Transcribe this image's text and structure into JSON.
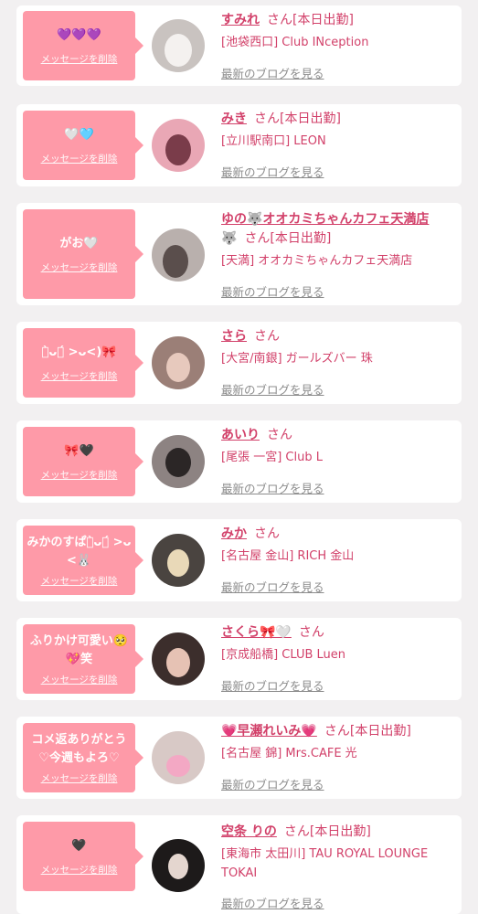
{
  "common": {
    "delete_label": "メッセージを削除",
    "blog_label": "最新のブログを見る"
  },
  "cards": [
    {
      "message": "💜💜💜",
      "name": "すみれ",
      "suffix": "さん[本日出勤]",
      "shop": "[池袋西口] Club INception",
      "avatar_color": "#c9c3c0",
      "avatar_accent": "#f4f1ef"
    },
    {
      "message": "🤍🩵",
      "name": "みき",
      "suffix": "さん[本日出勤]",
      "shop": "[立川駅南口] LEON",
      "avatar_color": "#e9a7b5",
      "avatar_accent": "#7a3c4a"
    },
    {
      "message": "がお🤍",
      "name": "ゆの🐺オオカミちゃんカフェ天満店",
      "name_line2": "🐺",
      "suffix": "さん[本日出勤]",
      "shop": "[天満] オオカミちゃんカフェ天満店",
      "avatar_color": "#b9b0ad",
      "avatar_accent": "#5a4e4c"
    },
    {
      "message": "ก̀ᴗก́ >ᴗ<)🎀",
      "name": "さら",
      "suffix": "さん",
      "shop": "[大宮/南銀] ガールズバー 珠",
      "avatar_color": "#9b7f77",
      "avatar_accent": "#e7c9bd"
    },
    {
      "message": "🎀🖤",
      "name": "あいり",
      "suffix": "さん",
      "shop": "[尾張 一宮] Club L",
      "avatar_color": "#8d8382",
      "avatar_accent": "#2b2626"
    },
    {
      "message": "みかのすぱก̀ᴗก́ >ᴗ<🐰",
      "name": "みか",
      "suffix": "さん",
      "shop": "[名古屋 金山] RICH 金山",
      "avatar_color": "#4a4440",
      "avatar_accent": "#e9d9b8"
    },
    {
      "message": "ふりかけ可愛い🥺💖笑",
      "name": "さくら🎀🤍",
      "suffix": "さん",
      "shop": "[京成船橋] CLUB Luen",
      "avatar_color": "#3c2e2c",
      "avatar_accent": "#e6c2b4"
    },
    {
      "message": "コメ返ありがとう♡今週もよろ♡",
      "name": "💗早瀬れいみ💗",
      "suffix": "さん[本日出勤]",
      "shop": "[名古屋 錦] Mrs.CAFE 光",
      "avatar_color": "#d8c9c6",
      "avatar_accent": "#f3a8c4"
    },
    {
      "message": "🖤",
      "name": "空条 りの",
      "suffix": "さん[本日出勤]",
      "shop": "[東海市 太田川] TAU ROYAL LOUNGE TOKAI",
      "avatar_color": "#1d1a1a",
      "avatar_accent": "#e4d6cf"
    }
  ]
}
